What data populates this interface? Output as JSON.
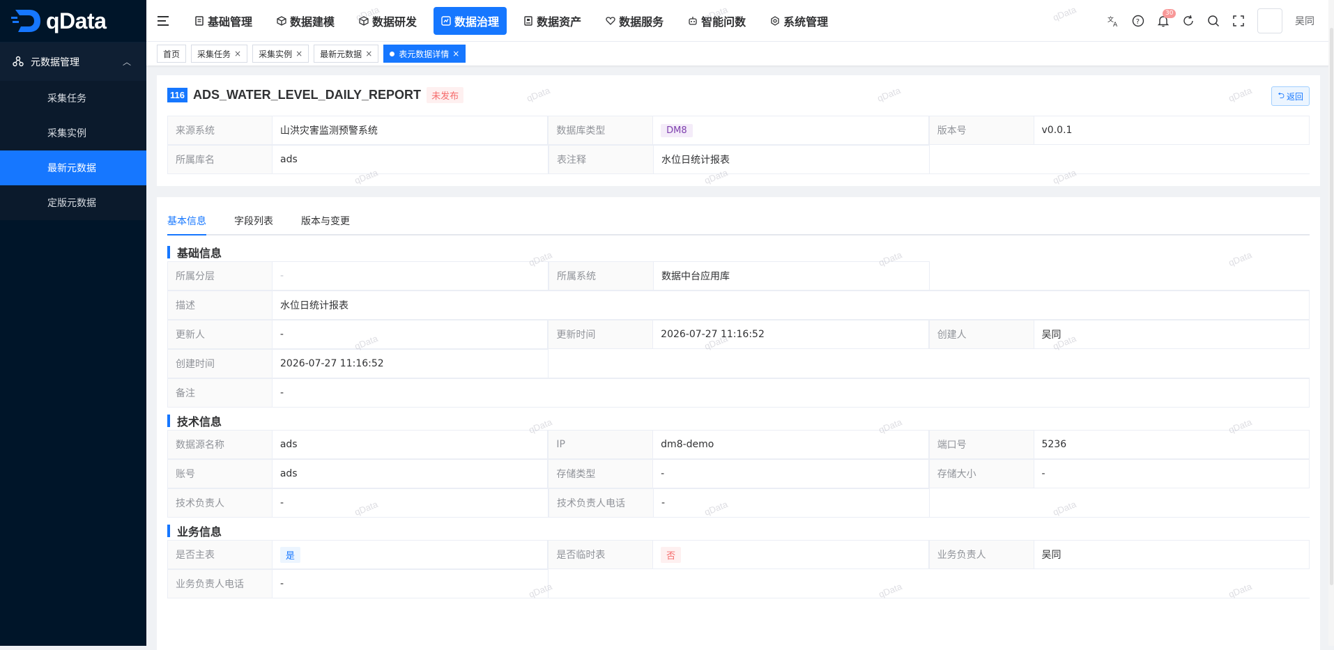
{
  "app": {
    "logo_text": "qData",
    "user_name": "吴同",
    "notification_count": "30",
    "watermark": "qData"
  },
  "sidebar": {
    "group_label": "元数据管理",
    "items": [
      {
        "label": "采集任务",
        "active": false
      },
      {
        "label": "采集实例",
        "active": false
      },
      {
        "label": "最新元数据",
        "active": true
      },
      {
        "label": "定版元数据",
        "active": false
      }
    ]
  },
  "topnav": {
    "items": [
      {
        "label": "基础管理",
        "icon": "doc-icon"
      },
      {
        "label": "数据建模",
        "icon": "cube-icon"
      },
      {
        "label": "数据研发",
        "icon": "cube-icon"
      },
      {
        "label": "数据治理",
        "icon": "governance-icon",
        "active": true
      },
      {
        "label": "数据资产",
        "icon": "asset-icon"
      },
      {
        "label": "数据服务",
        "icon": "heart-icon"
      },
      {
        "label": "智能问数",
        "icon": "robot-icon"
      },
      {
        "label": "系统管理",
        "icon": "gear-icon"
      }
    ]
  },
  "tags": {
    "home": "首页",
    "items": [
      "采集任务",
      "采集实例",
      "最新元数据"
    ],
    "active": "表元数据详情"
  },
  "header": {
    "id": "116",
    "table_name": "ADS_WATER_LEVEL_DAILY_REPORT",
    "status": "未发布",
    "back_label": "返回",
    "source_system_label": "来源系统",
    "source_system": "山洪灾害监测预警系统",
    "db_type_label": "数据库类型",
    "db_type": "DM8",
    "version_label": "版本号",
    "version": "v0.0.1",
    "db_name_label": "所属库名",
    "db_name": "ads",
    "comment_label": "表注释",
    "comment": "水位日统计报表"
  },
  "tabs": [
    "基本信息",
    "字段列表",
    "版本与变更"
  ],
  "basic": {
    "title": "基础信息",
    "layer_label": "所属分层",
    "layer": "-",
    "system_label": "所属系统",
    "system": "数据中台应用库",
    "desc_label": "描述",
    "desc": "水位日统计报表",
    "updater_label": "更新人",
    "updater": "-",
    "update_time_label": "更新时间",
    "update_time": "2026-07-27 11:16:52",
    "creator_label": "创建人",
    "creator": "吴同",
    "create_time_label": "创建时间",
    "create_time": "2026-07-27 11:16:52",
    "remark_label": "备注",
    "remark": "-"
  },
  "tech": {
    "title": "技术信息",
    "ds_name_label": "数据源名称",
    "ds_name": "ads",
    "ip_label": "IP",
    "ip": "dm8-demo",
    "port_label": "端口号",
    "port": "5236",
    "account_label": "账号",
    "account": "ads",
    "storage_type_label": "存储类型",
    "storage_type": "-",
    "storage_size_label": "存储大小",
    "storage_size": "-",
    "owner_label": "技术负责人",
    "owner": "-",
    "owner_phone_label": "技术负责人电话",
    "owner_phone": "-"
  },
  "biz": {
    "title": "业务信息",
    "is_main_label": "是否主表",
    "is_main": "是",
    "is_temp_label": "是否临时表",
    "is_temp": "否",
    "owner_label": "业务负责人",
    "owner": "吴同",
    "owner_phone_label": "业务负责人电话",
    "owner_phone": "-"
  }
}
